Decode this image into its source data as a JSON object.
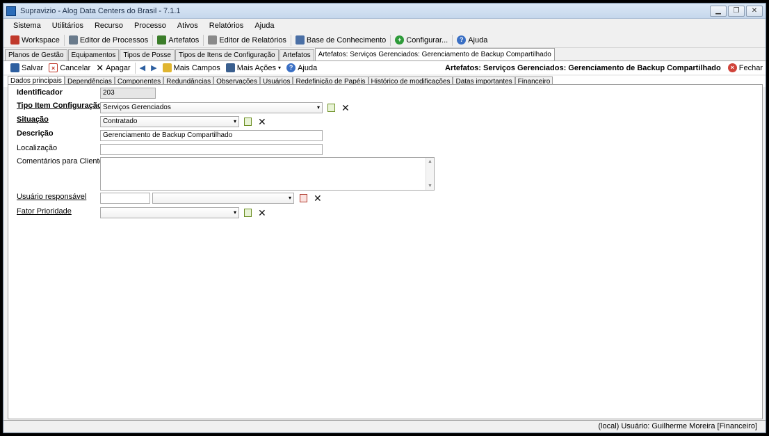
{
  "window": {
    "title": "Supravizio - Alog Data Centers do Brasil - 7.1.1",
    "btn_min": "▁",
    "btn_max": "❐",
    "btn_close": "✕"
  },
  "menu": [
    "Sistema",
    "Utilitários",
    "Recurso",
    "Processo",
    "Ativos",
    "Relatórios",
    "Ajuda"
  ],
  "toolbar": {
    "workspace": "Workspace",
    "editor_processos": "Editor de Processos",
    "artefatos": "Artefatos",
    "editor_relatorios": "Editor de Relatórios",
    "base_conhecimento": "Base de Conhecimento",
    "configurar": "Configurar...",
    "ajuda": "Ajuda"
  },
  "doc_tabs": [
    "Planos de Gestão",
    "Equipamentos",
    "Tipos de Posse",
    "Tipos de Itens de Configuração",
    "Artefatos",
    "Artefatos: Serviços Gerenciados: Gerenciamento de Backup Compartilhado"
  ],
  "actions": {
    "salvar": "Salvar",
    "cancelar": "Cancelar",
    "apagar": "Apagar",
    "mais_campos": "Mais Campos",
    "mais_acoes": "Mais Ações",
    "ajuda": "Ajuda",
    "title": "Artefatos: Serviços Gerenciados: Gerenciamento de Backup Compartilhado",
    "fechar": "Fechar"
  },
  "form_tabs": [
    "Dados principais",
    "Dependências",
    "Componentes",
    "Redundâncias",
    "Observações",
    "Usuários",
    "Redefinição de Papéis",
    "Histórico de modificações",
    "Datas importantes",
    "Financeiro"
  ],
  "form": {
    "identificador_label": "Identificador",
    "identificador_value": "203",
    "tipo_label": "Tipo Item Configuração",
    "tipo_value": "Serviços Gerenciados",
    "situacao_label": "Situação",
    "situacao_value": "Contratado",
    "descricao_label": "Descrição",
    "descricao_value": "Gerenciamento de Backup Compartilhado",
    "localizacao_label": "Localização",
    "localizacao_value": "",
    "comentarios_label": "Comentários para Cliente",
    "usuario_label": "Usuário responsável",
    "fator_label": "Fator Prioridade"
  },
  "status": {
    "text": "(local)  Usuário: Guilherme Moreira [Financeiro]"
  },
  "icons": {
    "dropdown": "▾",
    "scroll_up": "▲",
    "scroll_down": "▼",
    "delete": "✕",
    "nav_prev": "◀",
    "nav_next": "▶"
  }
}
